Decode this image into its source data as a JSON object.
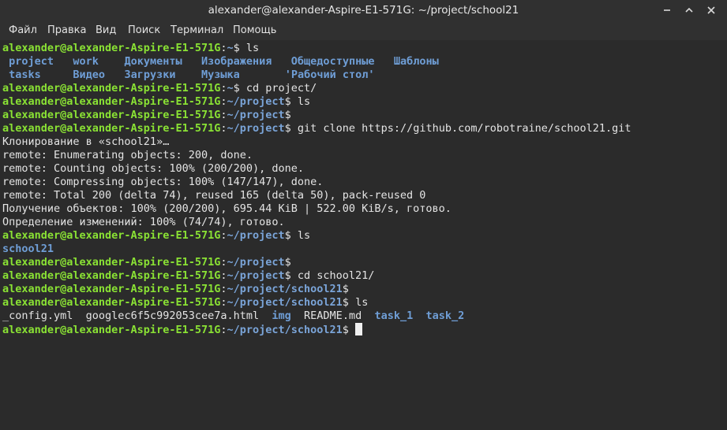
{
  "window": {
    "title": "alexander@alexander-Aspire-E1-571G: ~/project/school21"
  },
  "menu": [
    "Файл",
    "Правка",
    "Вид",
    "Поиск",
    "Терминал",
    "Помощь"
  ],
  "prompt": {
    "user": "alexander@alexander-Aspire-E1-571G",
    "sep": ":",
    "sign": "$ "
  },
  "lines": [
    {
      "type": "prompt",
      "path": "~",
      "cmd": "ls"
    },
    {
      "type": "list",
      "items": [
        {
          "t": " project",
          "k": "dir"
        },
        {
          "t": "   ",
          "k": "file"
        },
        {
          "t": "work",
          "k": "dir"
        },
        {
          "t": "    ",
          "k": "file"
        },
        {
          "t": "Документы",
          "k": "dir"
        },
        {
          "t": "   ",
          "k": "file"
        },
        {
          "t": "Изображения",
          "k": "dir"
        },
        {
          "t": "   ",
          "k": "file"
        },
        {
          "t": "Общедоступные",
          "k": "dir"
        },
        {
          "t": "   ",
          "k": "file"
        },
        {
          "t": "Шаблоны",
          "k": "dir"
        }
      ]
    },
    {
      "type": "list",
      "items": [
        {
          "t": " tasks",
          "k": "dir"
        },
        {
          "t": "     ",
          "k": "file"
        },
        {
          "t": "Видео",
          "k": "dir"
        },
        {
          "t": "   ",
          "k": "file"
        },
        {
          "t": "Загрузки",
          "k": "dir"
        },
        {
          "t": "    ",
          "k": "file"
        },
        {
          "t": "Музыка",
          "k": "dir"
        },
        {
          "t": "       ",
          "k": "file"
        },
        {
          "t": "'Рабочий стол'",
          "k": "dir"
        }
      ]
    },
    {
      "type": "prompt",
      "path": "~",
      "cmd": "cd project/"
    },
    {
      "type": "prompt",
      "path": "~/project",
      "cmd": "ls"
    },
    {
      "type": "prompt",
      "path": "~/project",
      "cmd": ""
    },
    {
      "type": "prompt",
      "path": "~/project",
      "cmd": "git clone https://github.com/robotraine/school21.git"
    },
    {
      "type": "text",
      "text": "Клонирование в «school21»…"
    },
    {
      "type": "text",
      "text": "remote: Enumerating objects: 200, done."
    },
    {
      "type": "text",
      "text": "remote: Counting objects: 100% (200/200), done."
    },
    {
      "type": "text",
      "text": "remote: Compressing objects: 100% (147/147), done."
    },
    {
      "type": "text",
      "text": "remote: Total 200 (delta 74), reused 165 (delta 50), pack-reused 0"
    },
    {
      "type": "text",
      "text": "Получение объектов: 100% (200/200), 695.44 KiB | 522.00 KiB/s, готово."
    },
    {
      "type": "text",
      "text": "Определение изменений: 100% (74/74), готово."
    },
    {
      "type": "prompt",
      "path": "~/project",
      "cmd": "ls"
    },
    {
      "type": "list",
      "items": [
        {
          "t": "school21",
          "k": "dir"
        }
      ]
    },
    {
      "type": "prompt",
      "path": "~/project",
      "cmd": ""
    },
    {
      "type": "prompt",
      "path": "~/project",
      "cmd": "cd school21/"
    },
    {
      "type": "prompt",
      "path": "~/project/school21",
      "cmd": ""
    },
    {
      "type": "prompt",
      "path": "~/project/school21",
      "cmd": "ls"
    },
    {
      "type": "list",
      "items": [
        {
          "t": "_config.yml",
          "k": "file"
        },
        {
          "t": "  ",
          "k": "file"
        },
        {
          "t": "googlec6f5c992053cee7a.html",
          "k": "file"
        },
        {
          "t": "  ",
          "k": "file"
        },
        {
          "t": "img",
          "k": "dir"
        },
        {
          "t": "  ",
          "k": "file"
        },
        {
          "t": "README.md",
          "k": "file"
        },
        {
          "t": "  ",
          "k": "file"
        },
        {
          "t": "task_1",
          "k": "dir"
        },
        {
          "t": "  ",
          "k": "file"
        },
        {
          "t": "task_2",
          "k": "dir"
        }
      ]
    },
    {
      "type": "prompt",
      "path": "~/project/school21",
      "cmd": "",
      "cursor": true
    }
  ],
  "colors": {
    "background": "#2b2b2b",
    "prompt_user": "#8ae234",
    "prompt_path": "#7aa4d8",
    "directory": "#6f9ed6",
    "text": "#e4e4e4"
  },
  "icons": {
    "minimize": "minimize-icon",
    "maximize": "maximize-icon",
    "close": "close-icon"
  }
}
